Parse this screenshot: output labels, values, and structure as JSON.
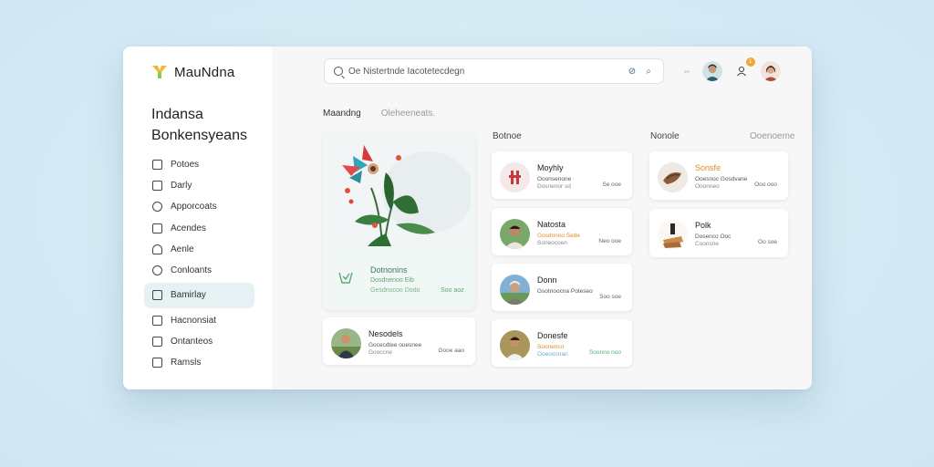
{
  "app": {
    "brand": "MauNdna"
  },
  "sidebar": {
    "title_line1": "Indansa",
    "title_line2": "Bonkensyeans",
    "items": [
      {
        "label": "Potoes"
      },
      {
        "label": "Darly"
      },
      {
        "label": "Apporcoats"
      },
      {
        "label": "Acendes"
      },
      {
        "label": "Aenle"
      },
      {
        "label": "Conloants"
      },
      {
        "label": "Bamirlay"
      },
      {
        "label": "Hacnonsiat"
      },
      {
        "label": "Ontanteos"
      },
      {
        "label": "Ramsls"
      }
    ]
  },
  "header": {
    "search_text": "Oe Nistertnde Iacotetecdegn",
    "notification_count": "1"
  },
  "tabs": [
    {
      "label": "Maandng"
    },
    {
      "label": "Oleheeneats."
    }
  ],
  "columns": {
    "col2": "Botnoe",
    "col3": "Nonole",
    "col3_link": "Ooenoeme"
  },
  "feature": {
    "title": "Dotnonins",
    "subtitle": "Dosdnenoo Eib",
    "detail": "Gesdnocoo Dodo",
    "value": "Soo aoz"
  },
  "col1_items": [
    {
      "title": "Nesodels",
      "line1": "Gocecdtee ouesnee",
      "line2": "Gooccne",
      "value": "Gooe aao"
    }
  ],
  "col2_items": [
    {
      "title": "Moyhly",
      "line1": "Ooonsenone",
      "line2": "Dosnenor sd",
      "value": "Se ooe"
    },
    {
      "title": "Natosta",
      "line1": "Gosdnnoo Sede",
      "line2": "Soneocoen",
      "value": "Neo ooe"
    },
    {
      "title": "Donn",
      "line1": "Gsotnoocna Poteseo",
      "line2": "",
      "value": "Soo soe"
    },
    {
      "title": "Donesfe",
      "line1": "Soonenco",
      "line2": "Ooeoocnan",
      "value": "Soonno noo"
    }
  ],
  "col3_items": [
    {
      "title": "Sonsfe",
      "line1": "Ooesnoc Gosdvane",
      "line2": "Ooonneo",
      "value": "Ooo ooo"
    },
    {
      "title": "Polk",
      "line1": "Dosenco Ooc",
      "line2": "Coonsne",
      "value": "Oo soe"
    }
  ],
  "colors": {
    "accent_green": "#5aa874",
    "accent_orange": "#e08a2a",
    "active_bg": "#e6f1f4"
  }
}
